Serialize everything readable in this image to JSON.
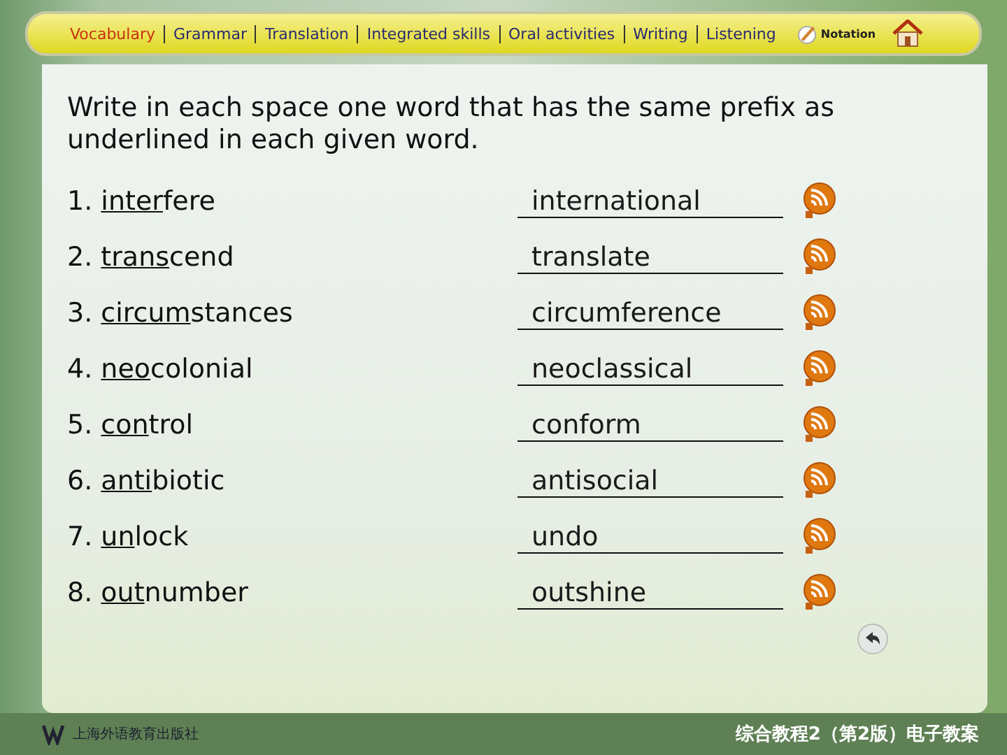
{
  "nav": [
    {
      "label": "Vocabulary",
      "selected": true
    },
    {
      "label": "Grammar",
      "selected": false
    },
    {
      "label": "Translation",
      "selected": false
    },
    {
      "label": "Integrated skills",
      "selected": false
    },
    {
      "label": "Oral activities",
      "selected": false
    },
    {
      "label": "Writing",
      "selected": false
    },
    {
      "label": "Listening",
      "selected": false
    }
  ],
  "notation": "Notation",
  "instruction": "Write in each space one word that has the same prefix as underlined in each given word.",
  "items": [
    {
      "number": "1.",
      "prefix": "inter",
      "rest": "fere",
      "answer": "international"
    },
    {
      "number": "2.",
      "prefix": "trans",
      "rest": "cend",
      "answer": "translate"
    },
    {
      "number": "3.",
      "prefix": "circum",
      "rest": "stances",
      "answer": "circumference"
    },
    {
      "number": "4.",
      "prefix": "neo",
      "rest": "colonial",
      "answer": "neoclassical"
    },
    {
      "number": "5.",
      "prefix": "con",
      "rest": "trol",
      "answer": "conform"
    },
    {
      "number": "6.",
      "prefix": "anti",
      "rest": "biotic",
      "answer": "antisocial"
    },
    {
      "number": "7.",
      "prefix": "un",
      "rest": "lock",
      "answer": "undo"
    },
    {
      "number": "8.",
      "prefix": "out",
      "rest": "number",
      "answer": "outshine"
    }
  ],
  "footer": {
    "publisher": "上海外语教育出版社",
    "course": "综合教程2（第2版）电子教案"
  }
}
